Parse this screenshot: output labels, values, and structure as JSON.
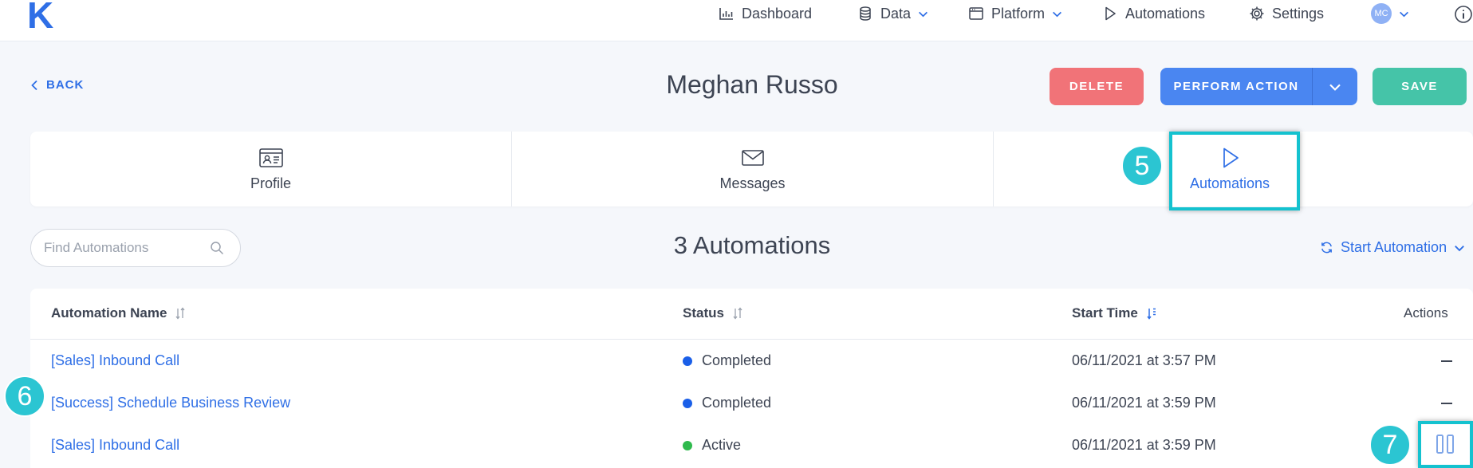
{
  "app": {
    "logo": "K"
  },
  "nav": {
    "items": [
      {
        "label": "Dashboard",
        "icon": "chart-icon"
      },
      {
        "label": "Data",
        "icon": "database-icon",
        "dropdown": true
      },
      {
        "label": "Platform",
        "icon": "window-icon",
        "dropdown": true
      },
      {
        "label": "Automations",
        "icon": "play-icon"
      },
      {
        "label": "Settings",
        "icon": "gear-icon"
      }
    ],
    "avatar_initials": "MC"
  },
  "header": {
    "back_label": "BACK",
    "title": "Meghan Russo",
    "delete_label": "DELETE",
    "perform_label": "PERFORM ACTION",
    "save_label": "SAVE"
  },
  "tabs": [
    {
      "label": "Profile",
      "icon": "id-card-icon"
    },
    {
      "label": "Messages",
      "icon": "envelope-icon"
    },
    {
      "label": "Automations",
      "icon": "play-icon",
      "active": true
    }
  ],
  "callouts": {
    "step5": "5",
    "step6": "6",
    "step7": "7"
  },
  "search": {
    "placeholder": "Find Automations",
    "value": ""
  },
  "summary": {
    "count_label": "3 Automations"
  },
  "start_automation_label": "Start Automation",
  "table": {
    "columns": [
      "Automation Name",
      "Status",
      "Start Time",
      "Actions"
    ],
    "rows": [
      {
        "name": "[Sales] Inbound Call",
        "status": "Completed",
        "status_color": "#1a5fe8",
        "start_time": "06/11/2021 at 3:57 PM",
        "action": "dash"
      },
      {
        "name": "[Success] Schedule Business Review",
        "status": "Completed",
        "status_color": "#1a5fe8",
        "start_time": "06/11/2021 at 3:59 PM",
        "action": "dash"
      },
      {
        "name": "[Sales] Inbound Call",
        "status": "Active",
        "status_color": "#2fba4d",
        "start_time": "06/11/2021 at 3:59 PM",
        "action": "pause-icon"
      }
    ]
  },
  "colors": {
    "accent": "#2f6fe6",
    "delete": "#f17378",
    "save": "#45c4a8",
    "perform": "#4a86f1",
    "callout": "#2bc5d2"
  }
}
